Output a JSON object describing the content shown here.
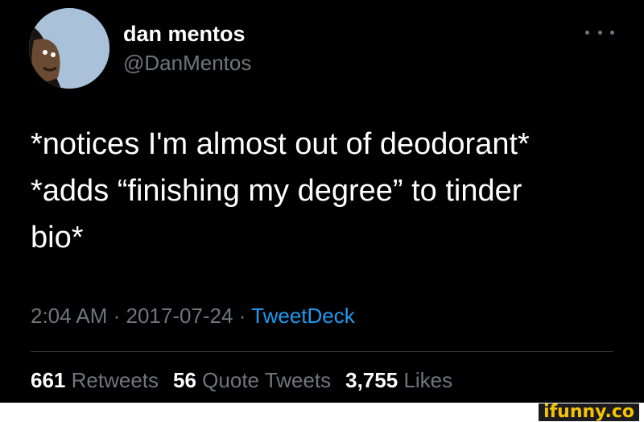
{
  "user": {
    "display_name": "dan mentos",
    "handle": "@DanMentos"
  },
  "tweet": {
    "lines": [
      "*notices I'm almost out of deodorant*",
      "*adds “finishing my degree” to tinder",
      "bio*"
    ]
  },
  "meta": {
    "time": "2:04 AM",
    "separator1": " · ",
    "date": "2017-07-24",
    "separator2": " · ",
    "source": "TweetDeck"
  },
  "stats": {
    "retweets_count": "661",
    "retweets_label": "Retweets",
    "quotes_count": "56",
    "quotes_label": "Quote Tweets",
    "likes_count": "3,755",
    "likes_label": "Likes"
  },
  "watermark": "ifunny.co",
  "colors": {
    "background": "#000000",
    "text": "#ffffff",
    "secondary": "#6e767d",
    "link": "#1d9bf0",
    "divider": "#2f3336",
    "watermark": "#f5c400"
  },
  "icons": {
    "more": "more-horizontal-icon"
  }
}
